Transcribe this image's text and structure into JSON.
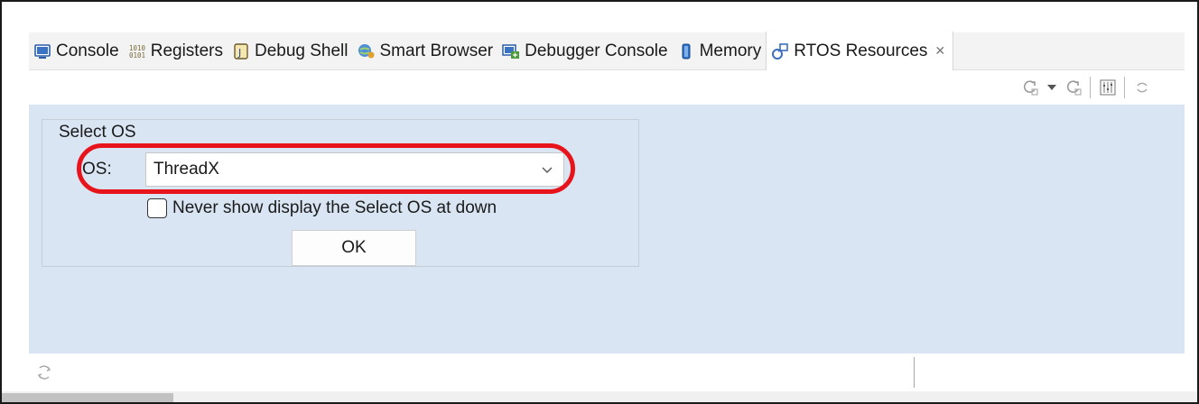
{
  "tabs": [
    {
      "label": "Console",
      "icon": "console-icon"
    },
    {
      "label": "Registers",
      "icon": "registers-icon"
    },
    {
      "label": "Debug Shell",
      "icon": "debug-shell-icon"
    },
    {
      "label": "Smart Browser",
      "icon": "smart-browser-icon"
    },
    {
      "label": "Debugger Console",
      "icon": "debugger-console-icon"
    },
    {
      "label": "Memory",
      "icon": "memory-icon"
    },
    {
      "label": "RTOS Resources",
      "icon": "rtos-resources-icon",
      "active": true,
      "close": "✕"
    }
  ],
  "toolbar": {
    "icons": [
      "refresh-icon",
      "dropdown-arrow-icon",
      "refresh-alt-icon",
      "settings-grid-icon",
      "sync-icon"
    ]
  },
  "select_os": {
    "group_label": "Select OS",
    "os_label": "OS:",
    "os_value": "ThreadX",
    "checkbox_label": "Never show display the Select OS at down",
    "checkbox_checked": false,
    "ok_label": "OK"
  },
  "colors": {
    "content_bg": "#d9e5f3",
    "highlight": "#e8141c",
    "tabbar_bg": "#f3f3f3"
  }
}
